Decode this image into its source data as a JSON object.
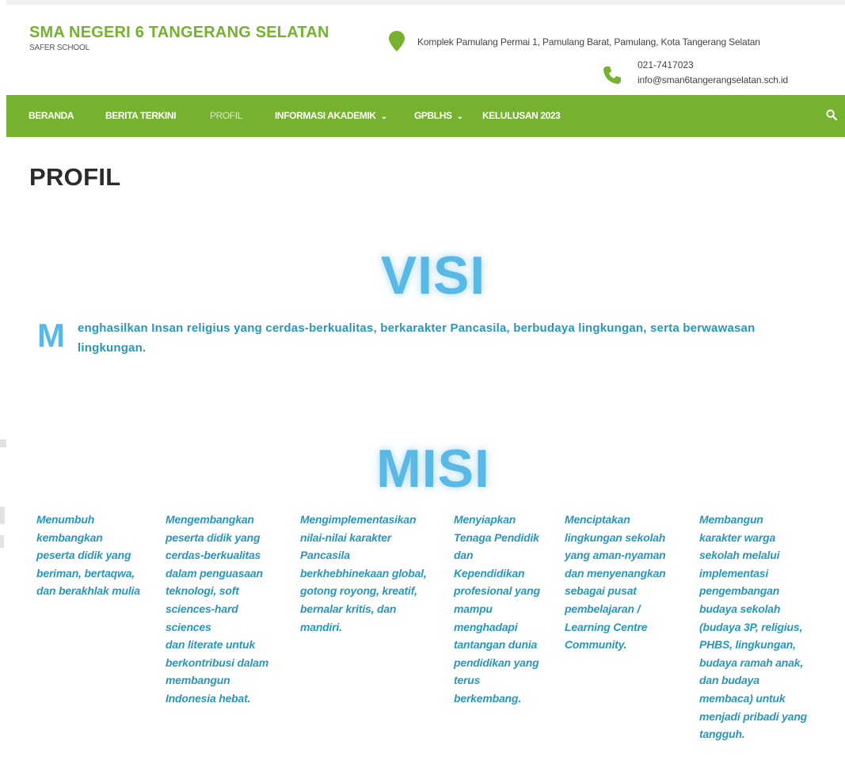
{
  "header": {
    "school_name": "SMA NEGERI 6 TANGERANG SELATAN",
    "tagline": "SAFER SCHOOL",
    "address": "Komplek Pamulang Permai 1, Pamulang Barat, Pamulang, Kota Tangerang Selatan",
    "phone": "021-7417023",
    "email": "info@sman6tangerangselatan.sch.id",
    "icons": [
      "map-pin-icon",
      "phone-icon"
    ]
  },
  "nav": {
    "items": [
      {
        "label": "BERANDA",
        "active": false,
        "dropdown": false
      },
      {
        "label": "BERITA TERKINI",
        "active": false,
        "dropdown": false
      },
      {
        "label": "PROFIL",
        "active": true,
        "dropdown": false
      },
      {
        "label": "INFORMASI AKADEMIK",
        "active": false,
        "dropdown": true
      },
      {
        "label": "GPBLHS",
        "active": false,
        "dropdown": true
      },
      {
        "label": "KELULUSAN 2023",
        "active": false,
        "dropdown": false
      }
    ],
    "caret_glyph": "⌄",
    "search_icon": "search-icon"
  },
  "page": {
    "title": "PROFIL"
  },
  "visi": {
    "heading": "VISI",
    "dropcap": "M",
    "text": "enghasilkan Insan religius yang cerdas-berkualitas, berkarakter Pancasila, berbudaya lingkungan, serta berwawasan lingkungan."
  },
  "misi": {
    "heading": "MISI",
    "columns": [
      {
        "lines": [
          "Menumbuh",
          "kembangkan",
          "peserta didik yang",
          "beriman, bertaqwa,",
          "dan berakhlak mulia"
        ]
      },
      {
        "lines": [
          "Mengembangkan",
          "peserta didik yang",
          "cerdas-berkualitas",
          "dalam penguasaan",
          "teknologi, soft",
          "sciences-hard",
          "sciences",
          "dan literate untuk",
          "berkontribusi dalam",
          "membangun",
          "Indonesia hebat."
        ]
      },
      {
        "lines": [
          "Mengimplementasikan",
          "nilai-nilai karakter",
          "Pancasila",
          "berkhebhinekaan global,",
          "gotong royong, kreatif,",
          "bernalar kritis, dan",
          "mandiri."
        ]
      },
      {
        "lines": [
          "Menyiapkan",
          "Tenaga Pendidik",
          "dan",
          "Kependidikan",
          "profesional yang",
          "mampu",
          "menghadapi",
          "tantangan dunia",
          "pendidikan yang",
          "terus",
          "berkembang."
        ]
      },
      {
        "lines": [
          "Menciptakan",
          "lingkungan sekolah",
          "yang aman-nyaman",
          "dan menyenangkan",
          "sebagai pusat",
          "pembelajaran /",
          "Learning  Centre",
          "Community."
        ]
      },
      {
        "lines": [
          "Membangun",
          "karakter warga",
          "sekolah melalui",
          "implementasi",
          "pengembangan",
          "budaya sekolah",
          "(budaya 3P, religius,",
          "PHBS, lingkungan,",
          "budaya ramah anak,",
          "dan budaya",
          "membaca) untuk",
          "menjadi pribadi yang",
          "tangguh."
        ]
      }
    ]
  },
  "colors": {
    "brand_green": "#76b12f",
    "heading_blue": "#5ab8e6",
    "text_blue": "#2a97b8"
  }
}
